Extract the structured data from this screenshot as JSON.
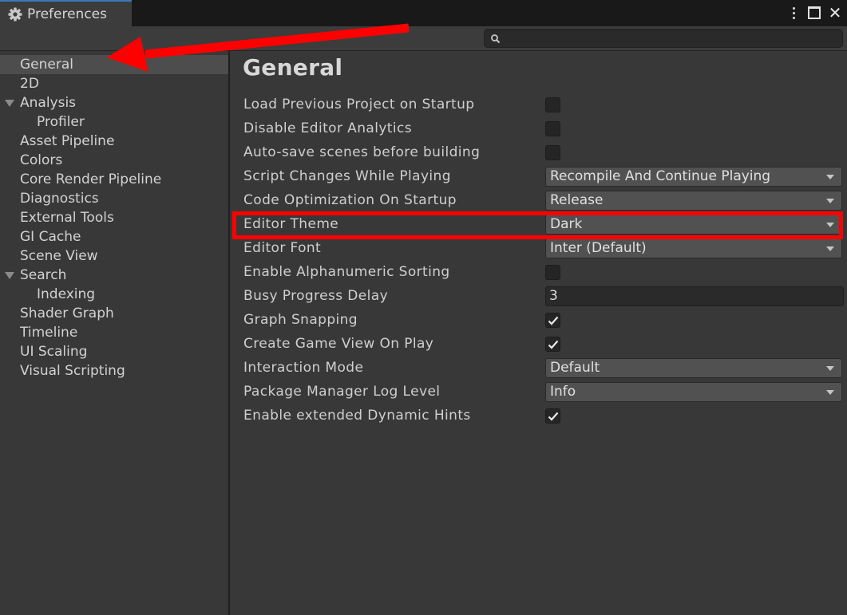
{
  "window": {
    "tab_title": "Preferences",
    "tab_icon": "gear-icon",
    "controls": [
      "kebab-menu-icon",
      "maximize-icon",
      "close-icon"
    ],
    "close_glyph": "✕"
  },
  "search": {
    "placeholder": "",
    "icon": "search-icon"
  },
  "sidebar": {
    "items": [
      {
        "label": "General"
      },
      {
        "label": "2D"
      },
      {
        "label": "Analysis"
      },
      {
        "label": "Profiler"
      },
      {
        "label": "Asset Pipeline"
      },
      {
        "label": "Colors"
      },
      {
        "label": "Core Render Pipeline"
      },
      {
        "label": "Diagnostics"
      },
      {
        "label": "External Tools"
      },
      {
        "label": "GI Cache"
      },
      {
        "label": "Scene View"
      },
      {
        "label": "Search"
      },
      {
        "label": "Indexing"
      },
      {
        "label": "Shader Graph"
      },
      {
        "label": "Timeline"
      },
      {
        "label": "UI Scaling"
      },
      {
        "label": "Visual Scripting"
      }
    ],
    "selected": "General"
  },
  "main": {
    "title": "General",
    "settings": [
      {
        "label": "Load Previous Project on Startup",
        "type": "checkbox",
        "checked": false
      },
      {
        "label": "Disable Editor Analytics",
        "type": "checkbox",
        "checked": false
      },
      {
        "label": "Auto-save scenes before building",
        "type": "checkbox",
        "checked": false
      },
      {
        "label": "Script Changes While Playing",
        "type": "dropdown",
        "value": "Recompile And Continue Playing"
      },
      {
        "label": "Code Optimization On Startup",
        "type": "dropdown",
        "value": "Release"
      },
      {
        "label": "Editor Theme",
        "type": "dropdown",
        "value": "Dark"
      },
      {
        "label": "Editor Font",
        "type": "dropdown",
        "value": "Inter (Default)"
      },
      {
        "label": "Enable Alphanumeric Sorting",
        "type": "checkbox",
        "checked": false
      },
      {
        "label": "Busy Progress Delay",
        "type": "text",
        "value": "3"
      },
      {
        "label": "Graph Snapping",
        "type": "checkbox",
        "checked": true
      },
      {
        "label": "Create Game View On Play",
        "type": "checkbox",
        "checked": true
      },
      {
        "label": "Interaction Mode",
        "type": "dropdown",
        "value": "Default"
      },
      {
        "label": "Package Manager Log Level",
        "type": "dropdown",
        "value": "Info"
      },
      {
        "label": "Enable extended Dynamic Hints",
        "type": "checkbox",
        "checked": true
      }
    ]
  },
  "annotations": {
    "highlight_color": "#ff0000",
    "arrow_color": "#ff0000",
    "highlighted_setting": "Editor Theme",
    "arrow_target": "General"
  },
  "colors": {
    "accent_tab": "#3a79bb",
    "panel_bg": "#383838",
    "selected_item_bg": "#4d4d4d"
  }
}
